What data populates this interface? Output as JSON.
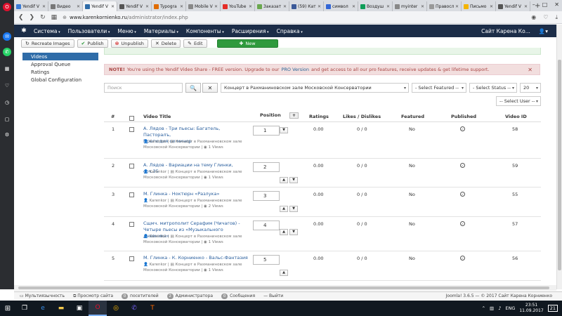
{
  "browser": {
    "tabs": [
      {
        "title": "Yendif V",
        "color": "#3a7bd5"
      },
      {
        "title": "Видео",
        "color": "#777777"
      },
      {
        "title": "Yendif V",
        "color": "#2f6ca8",
        "active": true
      },
      {
        "title": "Yendif V",
        "color": "#555555"
      },
      {
        "title": "Typogra",
        "color": "#e06c00"
      },
      {
        "title": "Mobile V",
        "color": "#888888"
      },
      {
        "title": "YouTube",
        "color": "#e52d27"
      },
      {
        "title": "Заказат",
        "color": "#6aa84f"
      },
      {
        "title": "(59) Кат",
        "color": "#3b5998"
      },
      {
        "title": "символ",
        "color": "#3367d6"
      },
      {
        "title": "Воздуш",
        "color": "#0f9d58"
      },
      {
        "title": "myinter",
        "color": "#888888"
      },
      {
        "title": "Правосл",
        "color": "#999999"
      },
      {
        "title": "Письмо",
        "color": "#f4b400"
      },
      {
        "title": "Yendif V",
        "color": "#555555"
      }
    ],
    "url_host": "www.karenkornienko.ru",
    "url_path": "/administrator/index.php"
  },
  "nav": {
    "items": [
      "Система",
      "Пользователи",
      "Меню",
      "Материалы",
      "Компоненты",
      "Расширения",
      "Справка"
    ],
    "site": "Сайт Карена Ко...",
    "user_icon": "user-icon"
  },
  "toolbar": {
    "recreate": "Recreate Images",
    "publish": "Publish",
    "unpublish": "Unpublish",
    "delete": "Delete",
    "edit": "Edit",
    "new": "New"
  },
  "submenu": [
    "Videos",
    "Approval Queue",
    "Ratings",
    "Global Configuration"
  ],
  "notice": {
    "label": "NOTE!",
    "text1": "You're using the Yendif Video Share - FREE version. Upgrade to our",
    "link": "PRO Version",
    "text2": "and get access to all our pro features, receive updates & get lifetime support."
  },
  "filters": {
    "search_placeholder": "Поиск",
    "category": "Концерт в Рахманиновском зале Московской Консерватории",
    "featured": "- Select Featured --",
    "status": "- Select Status --",
    "limit": "20",
    "user": "-- Select User --"
  },
  "table": {
    "headers": {
      "num": "#",
      "title": "Video Title",
      "position": "Position",
      "ratings": "Ratings",
      "likes": "Likes / Dislikes",
      "featured": "Featured",
      "published": "Published",
      "id": "Video ID"
    },
    "rows": [
      {
        "num": "1",
        "title1": "А. Лядов - Три пьесы: Багатель, Пасторалъ,",
        "title2": "Прелюдия си минор",
        "author": "Karenkor",
        "cat1": "Концерт в Рахманиновском зале",
        "cat2": "Московской Консерватории",
        "views": "1 Views",
        "position": "1",
        "ratings": "0.00",
        "likes": "0 / 0",
        "featured": "No",
        "id": "58"
      },
      {
        "num": "2",
        "title1": "А. Лядов - Вариации на тему Глинки, соч.35",
        "title2": "",
        "author": "Karenkor",
        "cat1": "Концерт в Рахманиновском зале",
        "cat2": "Московской Консерватории",
        "views": "1 Views",
        "position": "2",
        "ratings": "0.00",
        "likes": "0 / 0",
        "featured": "No",
        "id": "59"
      },
      {
        "num": "3",
        "title1": "М. Глинка - Ноктюрн «Разлука»",
        "title2": "",
        "author": "Karenkor",
        "cat1": "Концерт в Рахманиновском зале",
        "cat2": "Московской Консерватории",
        "views": "2 Views",
        "position": "3",
        "ratings": "0.00",
        "likes": "0 / 0",
        "featured": "No",
        "id": "55"
      },
      {
        "num": "4",
        "title1": "Сщмч. митрополит Серафим (Чичагов) -",
        "title2": "Четыре пьесы из «Музыкального дневника»",
        "author": "Karenkor",
        "cat1": "Концерт в Рахманиновском зале",
        "cat2": "Московской Консерватории",
        "views": "1 Views",
        "position": "4",
        "ratings": "0.00",
        "likes": "0 / 0",
        "featured": "No",
        "id": "57"
      },
      {
        "num": "5",
        "title1": "М. Глинка - К. Корниенко - Вальс-Фантазия",
        "title2": "",
        "author": "Karenkor",
        "cat1": "Концерт в Рахманиновском зале",
        "cat2": "Московской Консерватории",
        "views": "1 Views",
        "position": "5",
        "ratings": "0.00",
        "likes": "0 / 0",
        "featured": "No",
        "id": "56"
      }
    ]
  },
  "statusbar": {
    "multilang": "Мультиязычность",
    "view_site": "Просмотр сайта",
    "visitors_count": "0",
    "visitors": "посетителей",
    "admins_count": "2",
    "admins": "Администратора",
    "messages_count": "0",
    "messages": "Сообщения",
    "logout": "Выйти",
    "copyright": "Joomla! 3.6.5 — © 2017 Сайт Карена Корниенко"
  },
  "taskbar": {
    "lang": "ENG",
    "time": "23:51",
    "date": "11.09.2017",
    "notif": "21"
  }
}
